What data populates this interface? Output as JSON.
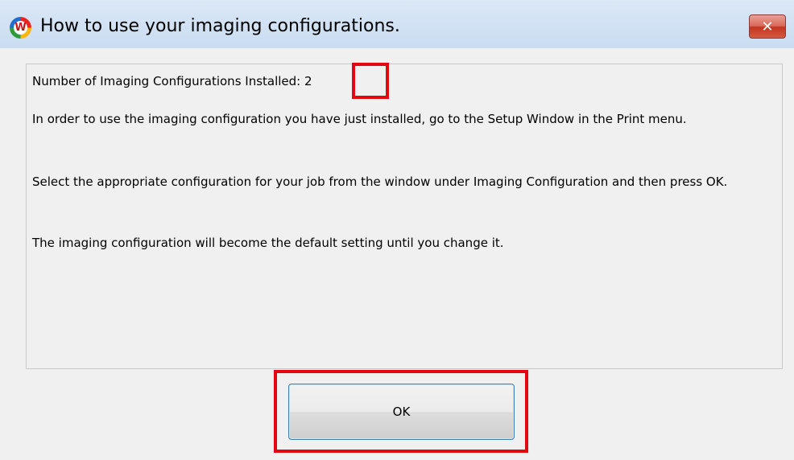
{
  "window": {
    "title": "How to use your imaging configurations.",
    "app_icon_letter": "W",
    "close_symbol": "✕"
  },
  "content": {
    "count_label": "Number of Imaging Configurations Installed:",
    "count_value": "2",
    "paragraph1": "In order to use the imaging configuration you have just installed, go to the Setup Window in the Print menu.",
    "paragraph2": "Select the appropriate configuration for your job from the window under Imaging Configuration and then press OK.",
    "paragraph3": "The imaging configuration will become the default setting until you change it."
  },
  "buttons": {
    "ok_label": "OK"
  },
  "colors": {
    "highlight": "#e30613",
    "titlebar": "#c9dcf1",
    "dialog_background": "#f0f0f0"
  }
}
